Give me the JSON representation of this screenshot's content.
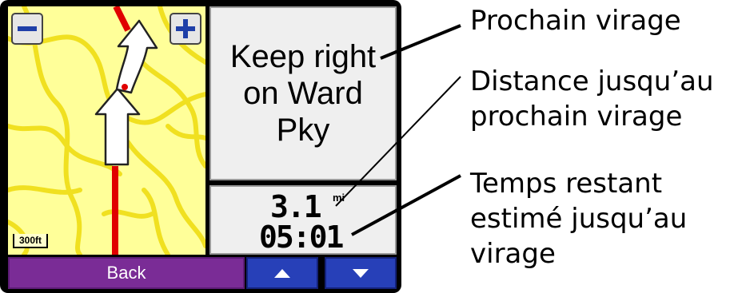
{
  "map": {
    "zoom_out_icon": "minus-icon",
    "zoom_in_icon": "plus-icon",
    "scale_label": "300ft",
    "route_color": "#e00000",
    "road_color": "#f0e020",
    "background_color": "#ffff99"
  },
  "turn_panel": {
    "instruction": "Keep right on Ward Pky"
  },
  "info_panel": {
    "distance": "3.1",
    "distance_unit": "mi",
    "time": "05:01"
  },
  "toolbar": {
    "back_label": "Back",
    "up_icon": "triangle-up-icon",
    "down_icon": "triangle-down-icon",
    "back_color": "#7a2c96",
    "arrow_color": "#2740b8"
  },
  "callouts": {
    "next_turn": "Prochain virage",
    "distance_line1": "Distance jusqu’au",
    "distance_line2": "prochain virage",
    "time_line1": "Temps restant",
    "time_line2": "estimé jusqu’au",
    "time_line3": "virage"
  }
}
